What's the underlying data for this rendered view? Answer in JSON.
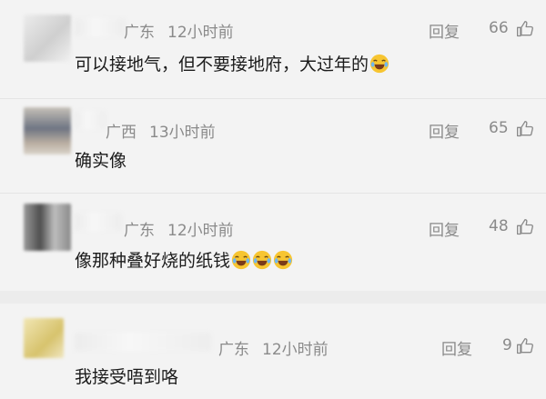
{
  "comments": [
    {
      "location": "广东",
      "time": "12小时前",
      "text": "可以接地气，但不要接地府，大过年的",
      "emojis": [
        "laughing-tears-emoji"
      ],
      "reply_label": "回复",
      "likes": "66",
      "avatar_colors": [
        "#e6e6e6",
        "#c9c9c9",
        "#f0f0f0"
      ]
    },
    {
      "location": "广西",
      "time": "13小时前",
      "text": "确实像",
      "emojis": [],
      "reply_label": "回复",
      "likes": "65",
      "avatar_colors": [
        "#b9b1a4",
        "#6f7583",
        "#d8d1c6"
      ]
    },
    {
      "location": "广东",
      "time": "12小时前",
      "text": "像那种叠好烧的纸钱",
      "emojis": [
        "laughing-tears-emoji",
        "laughing-tears-emoji",
        "laughing-tears-emoji"
      ],
      "reply_label": "回复",
      "likes": "48",
      "avatar_colors": [
        "#8d8d8d",
        "#5b5b5b",
        "#c7c7c7"
      ]
    },
    {
      "location": "广东",
      "time": "12小时前",
      "text": "我接受唔到咯",
      "emojis": [],
      "reply_label": "回复",
      "likes": "9",
      "avatar_colors": [
        "#efe2a6",
        "#d9c46a",
        "#f3ebc6"
      ]
    }
  ],
  "icons": {
    "like": "thumb-up-icon",
    "emoji": "laughing-tears-emoji"
  },
  "colors": {
    "background": "#f3f3f3",
    "meta_text": "#8a8a8a",
    "body_text": "#1b1b1b"
  }
}
